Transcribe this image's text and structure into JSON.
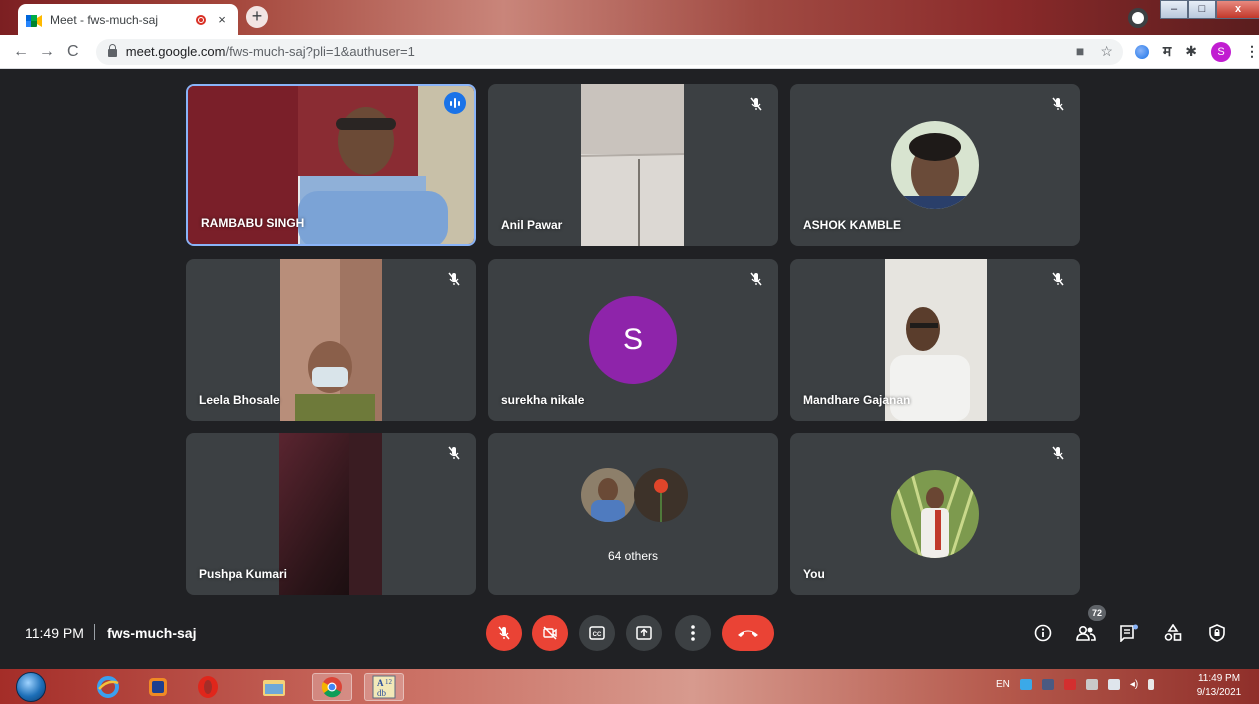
{
  "browser": {
    "tab_title": "Meet - fws-much-saj",
    "tab_close": "×",
    "new_tab": "+",
    "url_host": "meet.google.com",
    "url_path": "/fws-much-saj?pli=1&authuser=1",
    "profile_initial": "S"
  },
  "participants": [
    {
      "name": "RAMBABU SINGH",
      "speaking": true,
      "muted": false
    },
    {
      "name": "Anil Pawar",
      "muted": true
    },
    {
      "name": "ASHOK KAMBLE",
      "muted": true
    },
    {
      "name": "Leela Bhosale",
      "muted": true
    },
    {
      "name": "surekha nikale",
      "muted": true,
      "avatar_letter": "S"
    },
    {
      "name": "Mandhare Gajanan",
      "muted": true
    },
    {
      "name": "Pushpa Kumari",
      "muted": true
    },
    {
      "name": "64 others"
    },
    {
      "name": "You",
      "muted": true
    }
  ],
  "controls": {
    "time": "11:49 PM",
    "meeting_code": "fws-much-saj",
    "people_count": "72"
  },
  "taskbar": {
    "lang": "EN",
    "time": "11:49 PM",
    "date": "9/13/2021"
  },
  "colors": {
    "meet_bg": "#202124",
    "tile_bg": "#3c4043",
    "red": "#ea4335",
    "speaking_border": "#8ab4f8",
    "avatar_purple": "#8e24aa"
  }
}
